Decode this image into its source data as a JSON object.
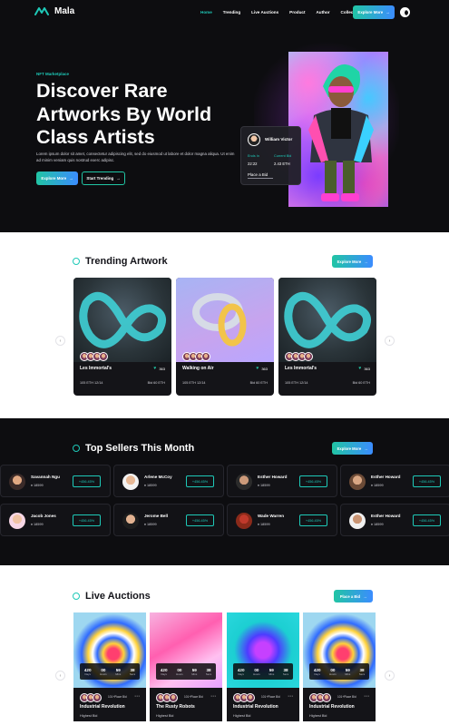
{
  "brand": {
    "name": "Mala"
  },
  "nav": {
    "items": [
      "Home",
      "Trending",
      "Live Auctions",
      "Product",
      "Author",
      "Collections"
    ],
    "cta": "Explore More"
  },
  "hero": {
    "eyebrow": "NFT Marketplace",
    "title": "Discover Rare Artworks By World Class Artists",
    "desc": "Lorem ipsum dolor sit amet, consectetur adipiscing elit, sed do eiusmod ut labore et dolor magna aliqua. Ut enim ad minim veniam quis nostrud exerc adipisc.",
    "btn_primary": "Explore More",
    "btn_secondary": "Start Trending",
    "bid_card": {
      "name": "William Victor",
      "ends_in_label": "Ends In",
      "ends_in_value": "22:22",
      "current_bid_label": "Current Bid",
      "current_bid_value": "2.43 ETH",
      "place_bid": "Place a Bid"
    }
  },
  "trending": {
    "title": "Trending Artwork",
    "btn": "Explore More",
    "cards": [
      {
        "title": "Les Immortal's",
        "likes": "363",
        "eth": "105 ETH 12/14",
        "bid": "Bid 60 ETH",
        "art": "infinity-ring"
      },
      {
        "title": "Walking on Air",
        "likes": "363",
        "eth": "105 ETH 12/14",
        "bid": "Bid 60 ETH",
        "art": "chain-rings"
      },
      {
        "title": "Les Immortal's",
        "likes": "363",
        "eth": "105 ETH 12/14",
        "bid": "Bid 60 ETH",
        "art": "infinity-ring"
      }
    ]
  },
  "sellers": {
    "title": "Top Sellers This Month",
    "btn": "Explore More",
    "items": [
      {
        "name": "Savannah Ngu",
        "eth": "18599",
        "pct": "+456.45%"
      },
      {
        "name": "Arlene McCoy",
        "eth": "18599",
        "pct": "+456.45%"
      },
      {
        "name": "Esther Howard",
        "eth": "18599",
        "pct": "+456.45%"
      },
      {
        "name": "Esther Howard",
        "eth": "18599",
        "pct": "+456.45%"
      },
      {
        "name": "Jacob Jones",
        "eth": "18599",
        "pct": "+456.45%"
      },
      {
        "name": "Jerome Bell",
        "eth": "18599",
        "pct": "+456.45%"
      },
      {
        "name": "Wade Warren",
        "eth": "18599",
        "pct": "+456.45%"
      },
      {
        "name": "Esther Howard",
        "eth": "18599",
        "pct": "+456.45%"
      }
    ]
  },
  "auctions": {
    "title": "Live Auctions",
    "btn": "Place a Bid",
    "timer_labels": [
      "Days",
      "Hours",
      "Mins",
      "Secs"
    ],
    "cards": [
      {
        "title": "Industrial Revolution",
        "place": "101+Place Bid",
        "highest": "Highest Bid",
        "timer": [
          "420",
          "00",
          "59",
          "38"
        ],
        "art": "swirl"
      },
      {
        "title": "The Rusty Robots",
        "place": "101+Place Bid",
        "highest": "Highest Bid",
        "timer": [
          "420",
          "00",
          "59",
          "38"
        ],
        "art": "pink"
      },
      {
        "title": "Industrial Revolution",
        "place": "101+Place Bid",
        "highest": "Highest Bid",
        "timer": [
          "420",
          "00",
          "59",
          "38"
        ],
        "art": "blue"
      },
      {
        "title": "Industrial Revolution",
        "place": "101+Place Bid",
        "highest": "Highest Bid",
        "timer": [
          "420",
          "00",
          "59",
          "38"
        ],
        "art": "swirl"
      }
    ]
  },
  "colors": {
    "accent": "#1ec9b8",
    "accent2": "#3b8cff",
    "dark": "#0d0d10"
  }
}
